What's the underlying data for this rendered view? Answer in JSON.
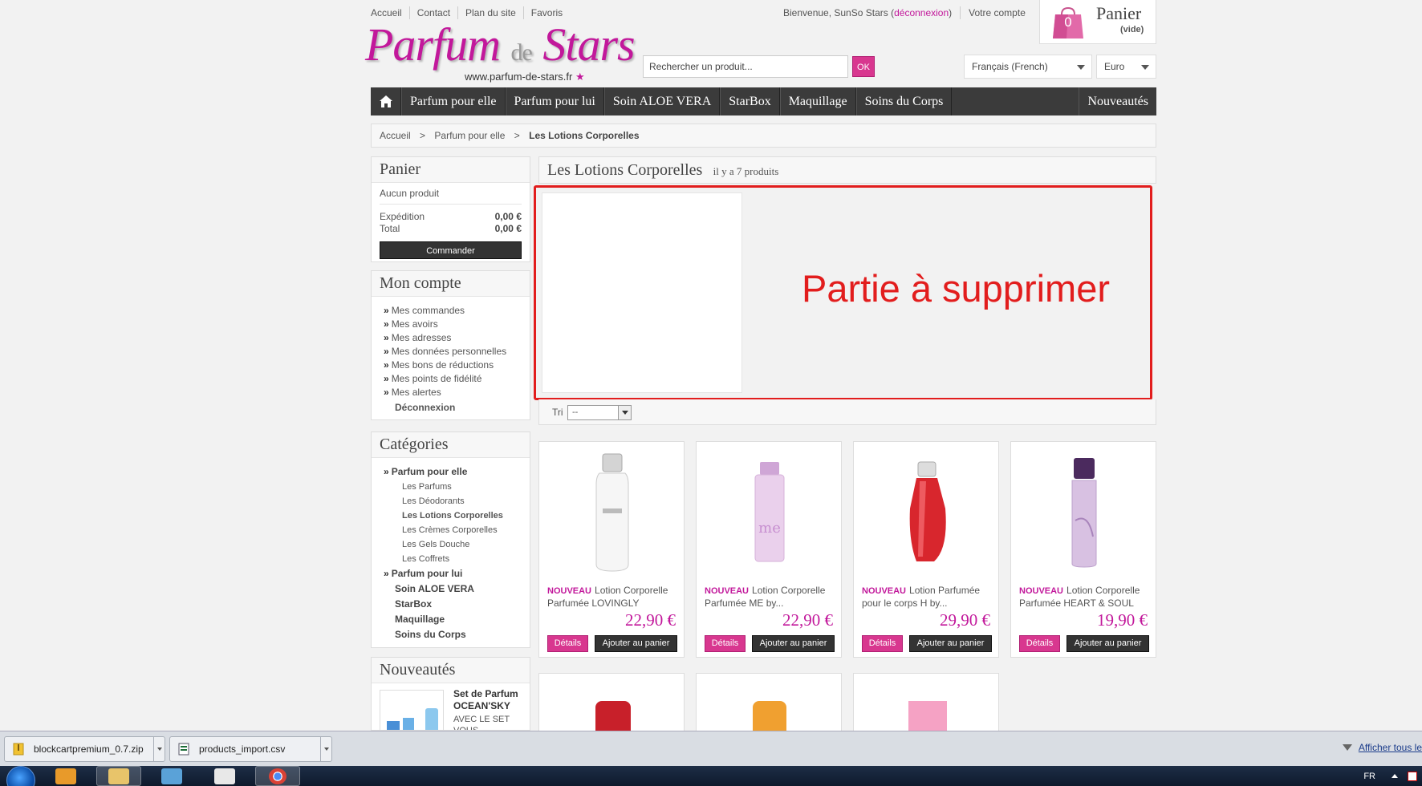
{
  "header": {
    "toplinks": [
      "Accueil",
      "Contact",
      "Plan du site",
      "Favoris"
    ],
    "welcome_prefix": "Bienvenue, SunSo Stars (",
    "logout": "déconnexion",
    "welcome_suffix": ")",
    "account": "Votre compte",
    "cart_title": "Panier",
    "cart_count": "0",
    "cart_empty": "(vide)",
    "logo_part1": "Parfum",
    "logo_part2": "de",
    "logo_part3": "Stars",
    "logo_url": "www.parfum-de-stars.fr",
    "search_placeholder": "Rechercher un produit...",
    "search_button": "OK",
    "language": "Français (French)",
    "currency": "Euro"
  },
  "nav": {
    "items": [
      "Parfum pour elle",
      "Parfum pour lui",
      "Soin ALOE VERA",
      "StarBox",
      "Maquillage",
      "Soins du Corps"
    ],
    "new": "Nouveautés"
  },
  "breadcrumb": [
    "Accueil",
    ">",
    "Parfum pour elle",
    ">",
    "Les Lotions Corporelles"
  ],
  "cart_block": {
    "title": "Panier",
    "no_product": "Aucun produit",
    "shipping_label": "Expédition",
    "shipping_value": "0,00 €",
    "total_label": "Total",
    "total_value": "0,00 €",
    "order_button": "Commander"
  },
  "account_block": {
    "title": "Mon compte",
    "items": [
      "Mes commandes",
      "Mes avoirs",
      "Mes adresses",
      "Mes données personnelles",
      "Mes bons de réductions",
      "Mes points de fidélité",
      "Mes alertes"
    ],
    "logout": "Déconnexion"
  },
  "categories_block": {
    "title": "Catégories",
    "top1": "Parfum pour elle",
    "subs": [
      "Les Parfums",
      "Les Déodorants",
      "Les Lotions Corporelles",
      "Les Crèmes Corporelles",
      "Les Gels Douche",
      "Les Coffrets"
    ],
    "top2": "Parfum pour lui",
    "others": [
      "Soin ALOE VERA",
      "StarBox",
      "Maquillage",
      "Soins du Corps"
    ]
  },
  "new_block": {
    "title": "Nouveautés",
    "product_name": "Set de Parfum OCEAN'SKY",
    "product_desc": "AVEC LE SET VOUS"
  },
  "main": {
    "category_title": "Les Lotions Corporelles",
    "count_text": "il y a 7 produits",
    "annotation": "Partie à supprimer",
    "sort_label": "Tri",
    "sort_value": "--"
  },
  "products": [
    {
      "badge": "NOUVEAU",
      "name": "Lotion Corporelle Parfumée LOVINGLY",
      "price": "22,90 €",
      "details": "Détails",
      "add": "Ajouter au panier",
      "color": "#f4f4f4"
    },
    {
      "badge": "NOUVEAU",
      "name": "Lotion Corporelle Parfumée ME by...",
      "price": "22,90 €",
      "details": "Détails",
      "add": "Ajouter au panier",
      "color": "#e7c6e6"
    },
    {
      "badge": "NOUVEAU",
      "name": "Lotion Parfumée pour le corps H by...",
      "price": "29,90 €",
      "details": "Détails",
      "add": "Ajouter au panier",
      "color": "#d8262d"
    },
    {
      "badge": "NOUVEAU",
      "name": "Lotion Corporelle Parfumée HEART & SOUL",
      "price": "19,90 €",
      "details": "Détails",
      "add": "Ajouter au panier",
      "color": "#c9b0d8"
    }
  ],
  "downloads": {
    "files": [
      "blockcartpremium_0.7.zip",
      "products_import.csv"
    ],
    "show_all": "Afficher tous le"
  },
  "taskbar": {
    "lang": "FR"
  }
}
